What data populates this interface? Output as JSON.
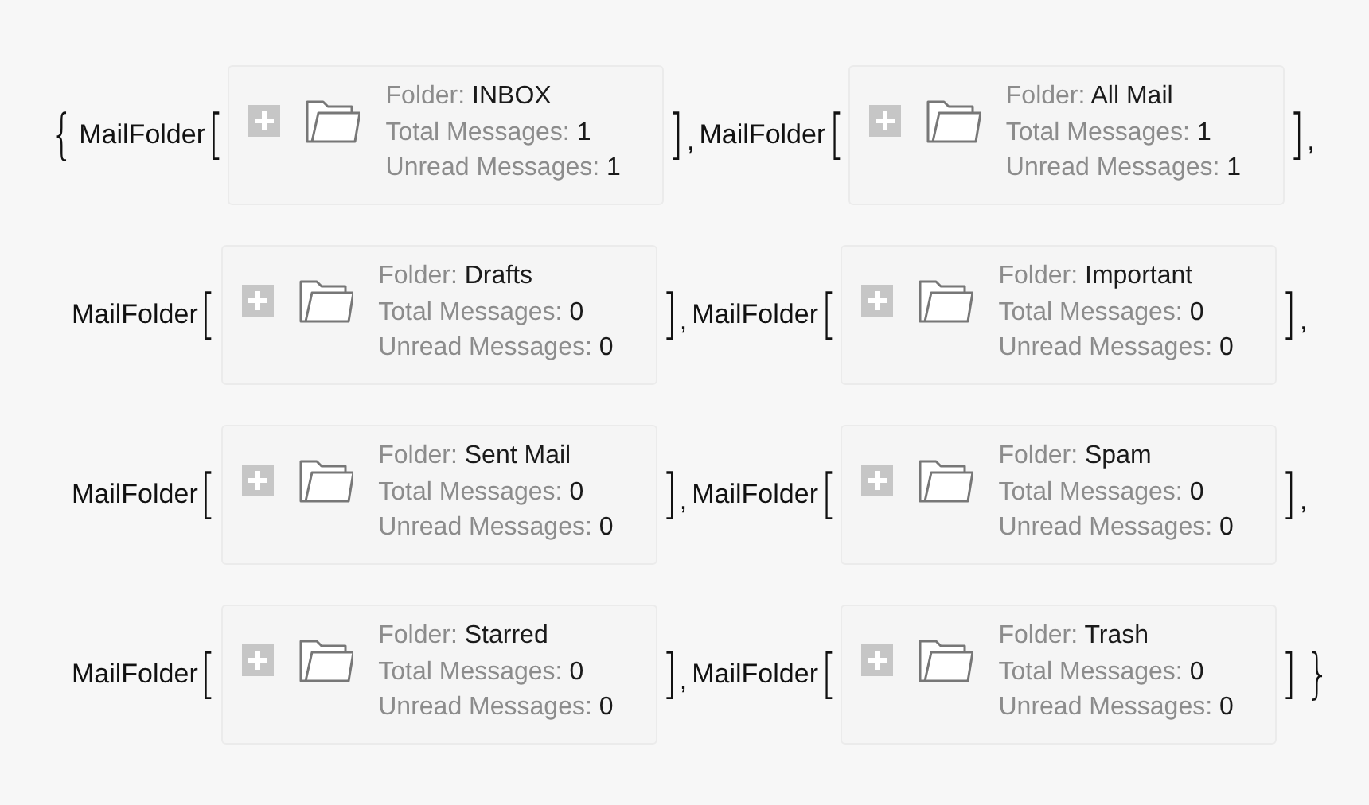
{
  "list_open": "{",
  "list_close": "}",
  "rows": [
    {
      "items": [
        {
          "head": "MailFolder",
          "open": "[",
          "close": "]",
          "after": ",",
          "fields": [
            {
              "label": "Folder:",
              "value": "INBOX"
            },
            {
              "label": "Total Messages:",
              "value": "1"
            },
            {
              "label": "Unread Messages:",
              "value": "1"
            }
          ]
        },
        {
          "head": "MailFolder",
          "open": "[",
          "close": "]",
          "after": ",",
          "fields": [
            {
              "label": "Folder:",
              "value": "All Mail"
            },
            {
              "label": "Total Messages:",
              "value": "1"
            },
            {
              "label": "Unread Messages:",
              "value": "1"
            }
          ]
        }
      ]
    },
    {
      "items": [
        {
          "head": "MailFolder",
          "open": "[",
          "close": "]",
          "after": ",",
          "fields": [
            {
              "label": "Folder:",
              "value": "Drafts"
            },
            {
              "label": "Total Messages:",
              "value": "0"
            },
            {
              "label": "Unread Messages:",
              "value": "0"
            }
          ]
        },
        {
          "head": "MailFolder",
          "open": "[",
          "close": "]",
          "after": ",",
          "fields": [
            {
              "label": "Folder:",
              "value": "Important"
            },
            {
              "label": "Total Messages:",
              "value": "0"
            },
            {
              "label": "Unread Messages:",
              "value": "0"
            }
          ]
        }
      ]
    },
    {
      "items": [
        {
          "head": "MailFolder",
          "open": "[",
          "close": "]",
          "after": ",",
          "fields": [
            {
              "label": "Folder:",
              "value": "Sent Mail"
            },
            {
              "label": "Total Messages:",
              "value": "0"
            },
            {
              "label": "Unread Messages:",
              "value": "0"
            }
          ]
        },
        {
          "head": "MailFolder",
          "open": "[",
          "close": "]",
          "after": ",",
          "fields": [
            {
              "label": "Folder:",
              "value": "Spam"
            },
            {
              "label": "Total Messages:",
              "value": "0"
            },
            {
              "label": "Unread Messages:",
              "value": "0"
            }
          ]
        }
      ]
    },
    {
      "items": [
        {
          "head": "MailFolder",
          "open": "[",
          "close": "]",
          "after": ",",
          "fields": [
            {
              "label": "Folder:",
              "value": "Starred"
            },
            {
              "label": "Total Messages:",
              "value": "0"
            },
            {
              "label": "Unread Messages:",
              "value": "0"
            }
          ]
        },
        {
          "head": "MailFolder",
          "open": "[",
          "close": "]",
          "fields": [
            {
              "label": "Folder:",
              "value": "Trash"
            },
            {
              "label": "Total Messages:",
              "value": "0"
            },
            {
              "label": "Unread Messages:",
              "value": "0"
            }
          ]
        }
      ]
    }
  ]
}
